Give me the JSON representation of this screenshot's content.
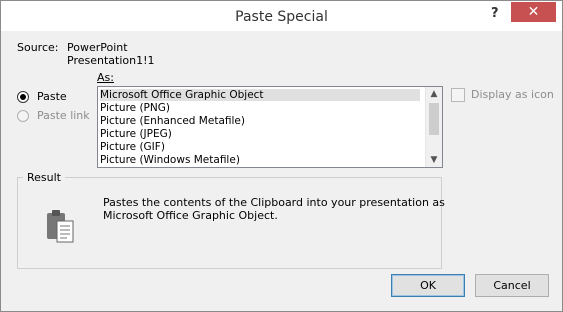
{
  "window": {
    "title": "Paste Special",
    "help": "?",
    "close": "✕"
  },
  "source": {
    "label": "Source:",
    "line1": "PowerPoint",
    "line2": "Presentation1!1"
  },
  "as_label": "As:",
  "options": {
    "paste": "Paste",
    "paste_link": "Paste link"
  },
  "formats": [
    "Microsoft Office Graphic Object",
    "Picture (PNG)",
    "Picture (Enhanced Metafile)",
    "Picture (JPEG)",
    "Picture (GIF)",
    "Picture (Windows Metafile)"
  ],
  "display_as_icon": "Display as icon",
  "result": {
    "legend": "Result",
    "text_line1": "Pastes the contents of the Clipboard into your presentation as",
    "text_line2": "Microsoft Office Graphic Object."
  },
  "buttons": {
    "ok": "OK",
    "cancel": "Cancel"
  }
}
